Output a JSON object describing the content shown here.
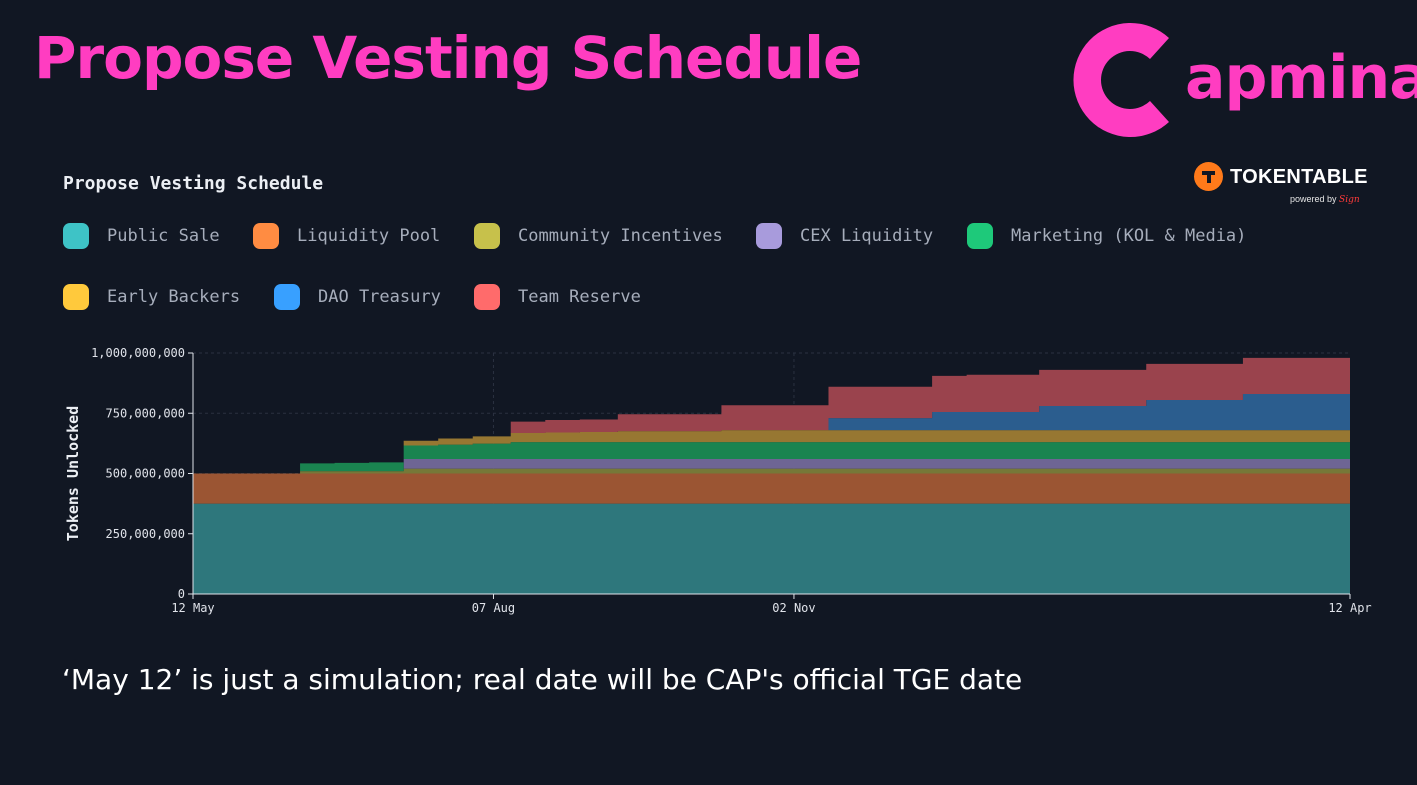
{
  "header": {
    "title": "Propose Vesting Schedule",
    "brand_text": "apminal",
    "brand_color": "#ff3dc1"
  },
  "tokentable": {
    "name": "TOKENTABLE",
    "powered_by": "powered by",
    "sign": "Sign",
    "accent": "#ff7a1a"
  },
  "footnote": "‘May 12’ is just a simulation; real date will be CAP's official TGE date",
  "chart_data": {
    "type": "area",
    "title": "Propose Vesting Schedule",
    "ylabel": "Tokens Unlocked",
    "xlabel": "",
    "x_start": "2024-05-12",
    "x_end": "2025-04-12",
    "xticks": [
      {
        "date": "2024-05-12",
        "label": "12 May"
      },
      {
        "date": "2024-08-07",
        "label": "07 Aug"
      },
      {
        "date": "2024-11-02",
        "label": "02 Nov"
      },
      {
        "date": "2025-04-12",
        "label": "12 Apr"
      }
    ],
    "ylim": [
      0,
      1000000000
    ],
    "yticks": [
      {
        "value": 0,
        "label": "0"
      },
      {
        "value": 250000000,
        "label": "250,000,000"
      },
      {
        "value": 500000000,
        "label": "500,000,000"
      },
      {
        "value": 750000000,
        "label": "750,000,000"
      },
      {
        "value": 1000000000,
        "label": "1,000,000,000"
      }
    ],
    "grid": true,
    "stacked": true,
    "step": true,
    "legend_position": "top-left",
    "series": [
      {
        "name": "Public Sale",
        "color": "#3ec3c6",
        "fill": "#2e777c",
        "points": [
          [
            "2024-05-12",
            375000000
          ]
        ]
      },
      {
        "name": "Liquidity Pool",
        "color": "#ff8c42",
        "fill": "#9b5533",
        "points": [
          [
            "2024-05-12",
            125000000
          ]
        ]
      },
      {
        "name": "Community Incentives",
        "color": "#c7c14b",
        "fill": "#767838",
        "points": [
          [
            "2024-05-12",
            0
          ],
          [
            "2024-06-12",
            10000000
          ],
          [
            "2024-07-12",
            20000000
          ],
          [
            "2024-08-12",
            20000000
          ]
        ]
      },
      {
        "name": "CEX Liquidity",
        "color": "#a89bdc",
        "fill": "#6e6594",
        "points": [
          [
            "2024-05-12",
            0
          ],
          [
            "2024-07-12",
            40000000
          ],
          [
            "2024-08-12",
            40000000
          ]
        ]
      },
      {
        "name": "Marketing (KOL & Media)",
        "color": "#1ec97a",
        "fill": "#1a8450",
        "points": [
          [
            "2024-05-12",
            0
          ],
          [
            "2024-06-12",
            32000000
          ],
          [
            "2024-06-22",
            34000000
          ],
          [
            "2024-07-02",
            36000000
          ],
          [
            "2024-07-12",
            56000000
          ],
          [
            "2024-07-22",
            60000000
          ],
          [
            "2024-08-01",
            64000000
          ],
          [
            "2024-08-12",
            70000000
          ],
          [
            "2024-09-12",
            70000000
          ]
        ]
      },
      {
        "name": "Early Backers",
        "color": "#ffc93c",
        "fill": "#977732",
        "points": [
          [
            "2024-05-12",
            0
          ],
          [
            "2024-07-12",
            20000000
          ],
          [
            "2024-07-22",
            25000000
          ],
          [
            "2024-08-01",
            30000000
          ],
          [
            "2024-08-12",
            38000000
          ],
          [
            "2024-08-22",
            40000000
          ],
          [
            "2024-09-01",
            42000000
          ],
          [
            "2024-09-12",
            46000000
          ],
          [
            "2024-10-12",
            50000000
          ],
          [
            "2024-11-12",
            50000000
          ]
        ]
      },
      {
        "name": "DAO Treasury",
        "color": "#38a0ff",
        "fill": "#2b5d8e",
        "points": [
          [
            "2024-05-12",
            0
          ],
          [
            "2024-11-12",
            50000000
          ],
          [
            "2024-12-12",
            75000000
          ],
          [
            "2025-01-12",
            100000000
          ],
          [
            "2025-02-12",
            125000000
          ],
          [
            "2025-03-12",
            150000000
          ]
        ]
      },
      {
        "name": "Team Reserve",
        "color": "#ff6b6b",
        "fill": "#9a434d",
        "points": [
          [
            "2024-05-12",
            0
          ],
          [
            "2024-08-12",
            47000000
          ],
          [
            "2024-08-22",
            52000000
          ],
          [
            "2024-09-12",
            70000000
          ],
          [
            "2024-10-12",
            103000000
          ],
          [
            "2024-11-12",
            130000000
          ],
          [
            "2024-12-12",
            150000000
          ],
          [
            "2024-12-22",
            155000000
          ],
          [
            "2025-01-12",
            150000000
          ],
          [
            "2025-02-12",
            150000000
          ],
          [
            "2025-03-12",
            150000000
          ]
        ]
      }
    ]
  }
}
